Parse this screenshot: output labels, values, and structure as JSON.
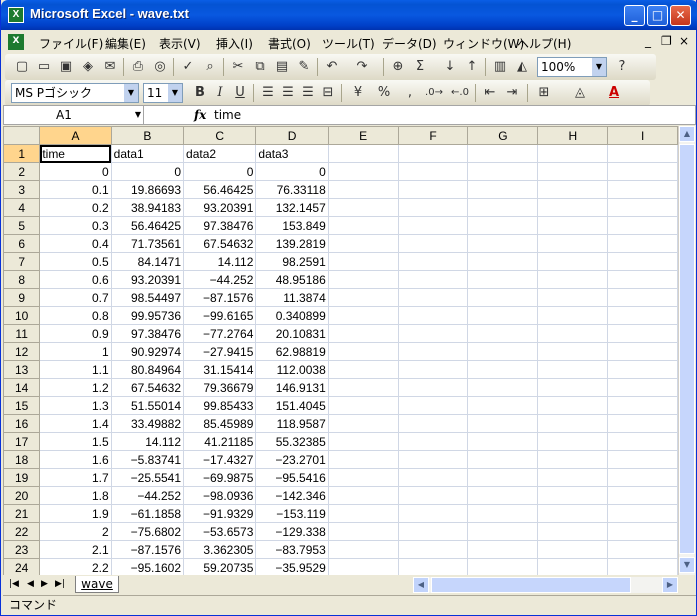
{
  "window": {
    "app_icon_label": "X",
    "title": "Microsoft Excel - wave.txt",
    "minimize": "_",
    "maximize": "□",
    "close": "✕"
  },
  "menubar": {
    "items": [
      "ファイル(F)",
      "編集(E)",
      "表示(V)",
      "挿入(I)",
      "書式(O)",
      "ツール(T)",
      "データ(D)",
      "ウィンドウ(W)",
      "ヘルプ(H)"
    ],
    "doc_minimize": "_",
    "doc_restore": "❐",
    "doc_close": "×"
  },
  "toolbar1": {
    "zoom": "100%",
    "icons": [
      "new-icon",
      "open-icon",
      "save-icon",
      "permission-icon",
      "mail-icon",
      "print-icon",
      "print-preview-icon",
      "spelling-icon",
      "cut-icon",
      "copy-icon",
      "paste-icon",
      "format-painter-icon",
      "undo-icon",
      "redo-icon",
      "hyperlink-icon",
      "autosum-icon",
      "sort-ascending-icon",
      "sort-descending-icon",
      "chart-wizard-icon",
      "drawing-icon",
      "help-icon"
    ]
  },
  "toolbar2": {
    "font_name": "MS Pゴシック",
    "font_size": "11",
    "bold": "B",
    "italic": "I",
    "underline": "U",
    "percent": "%",
    "comma": ",",
    "font_color_label": "A"
  },
  "formula_bar": {
    "cell_ref": "A1",
    "fx": "fx",
    "value": "time"
  },
  "columns": [
    "A",
    "B",
    "C",
    "D",
    "E",
    "F",
    "G",
    "H",
    "I"
  ],
  "rows": [
    {
      "n": "1",
      "cells": [
        "time",
        "data1",
        "data2",
        "data3"
      ]
    },
    {
      "n": "2",
      "cells": [
        "0",
        "0",
        "0",
        "0"
      ]
    },
    {
      "n": "3",
      "cells": [
        "0.1",
        "19.86693",
        "56.46425",
        "76.33118"
      ]
    },
    {
      "n": "4",
      "cells": [
        "0.2",
        "38.94183",
        "93.20391",
        "132.1457"
      ]
    },
    {
      "n": "5",
      "cells": [
        "0.3",
        "56.46425",
        "97.38476",
        "153.849"
      ]
    },
    {
      "n": "6",
      "cells": [
        "0.4",
        "71.73561",
        "67.54632",
        "139.2819"
      ]
    },
    {
      "n": "7",
      "cells": [
        "0.5",
        "84.1471",
        "14.112",
        "98.2591"
      ]
    },
    {
      "n": "8",
      "cells": [
        "0.6",
        "93.20391",
        "−44.252",
        "48.95186"
      ]
    },
    {
      "n": "9",
      "cells": [
        "0.7",
        "98.54497",
        "−87.1576",
        "11.3874"
      ]
    },
    {
      "n": "10",
      "cells": [
        "0.8",
        "99.95736",
        "−99.6165",
        "0.340899"
      ]
    },
    {
      "n": "11",
      "cells": [
        "0.9",
        "97.38476",
        "−77.2764",
        "20.10831"
      ]
    },
    {
      "n": "12",
      "cells": [
        "1",
        "90.92974",
        "−27.9415",
        "62.98819"
      ]
    },
    {
      "n": "13",
      "cells": [
        "1.1",
        "80.84964",
        "31.15414",
        "112.0038"
      ]
    },
    {
      "n": "14",
      "cells": [
        "1.2",
        "67.54632",
        "79.36679",
        "146.9131"
      ]
    },
    {
      "n": "15",
      "cells": [
        "1.3",
        "51.55014",
        "99.85433",
        "151.4045"
      ]
    },
    {
      "n": "16",
      "cells": [
        "1.4",
        "33.49882",
        "85.45989",
        "118.9587"
      ]
    },
    {
      "n": "17",
      "cells": [
        "1.5",
        "14.112",
        "41.21185",
        "55.32385"
      ]
    },
    {
      "n": "18",
      "cells": [
        "1.6",
        "−5.83741",
        "−17.4327",
        "−23.2701"
      ]
    },
    {
      "n": "19",
      "cells": [
        "1.7",
        "−25.5541",
        "−69.9875",
        "−95.5416"
      ]
    },
    {
      "n": "20",
      "cells": [
        "1.8",
        "−44.252",
        "−98.0936",
        "−142.346"
      ]
    },
    {
      "n": "21",
      "cells": [
        "1.9",
        "−61.1858",
        "−91.9329",
        "−153.119"
      ]
    },
    {
      "n": "22",
      "cells": [
        "2",
        "−75.6802",
        "−53.6573",
        "−129.338"
      ]
    },
    {
      "n": "23",
      "cells": [
        "2.1",
        "−87.1576",
        "3.362305",
        "−83.7953"
      ]
    },
    {
      "n": "24",
      "cells": [
        "2.2",
        "−95.1602",
        "59.20735",
        "−35.9529"
      ]
    }
  ],
  "sheet_tabs": [
    "wave"
  ],
  "status": "コマンド"
}
